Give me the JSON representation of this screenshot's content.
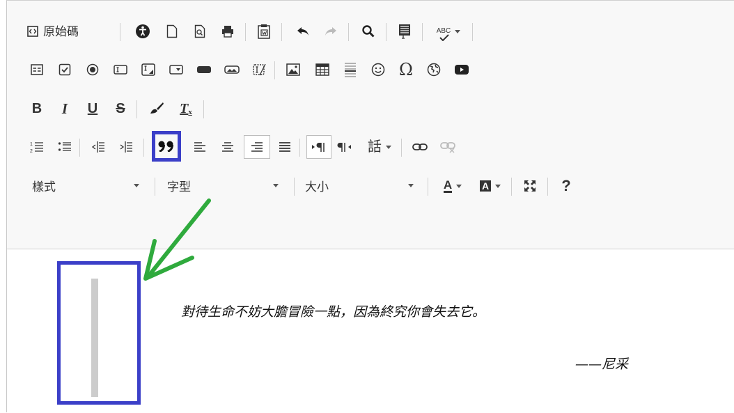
{
  "toolbar": {
    "source_label": "原始碼",
    "bold_label": "B",
    "italic_label": "I",
    "underline_label": "U",
    "strike_label": "S",
    "style_combo": "樣式",
    "font_combo": "字型",
    "size_combo": "大小",
    "lang_label": "話",
    "text_color_label": "A",
    "bg_color_label": "A",
    "help_label": "?",
    "omega_label": "Ω",
    "spell_label": "ABC",
    "remove_format_label": "T"
  },
  "content": {
    "quote_line": "對待生命不妨大膽冒險一點，因為終究你會失去它。",
    "attribution": "——尼采"
  },
  "colors": {
    "highlight": "#3b3fc8",
    "arrow": "#2faa3d",
    "blockquote_bar": "#cccccc"
  }
}
